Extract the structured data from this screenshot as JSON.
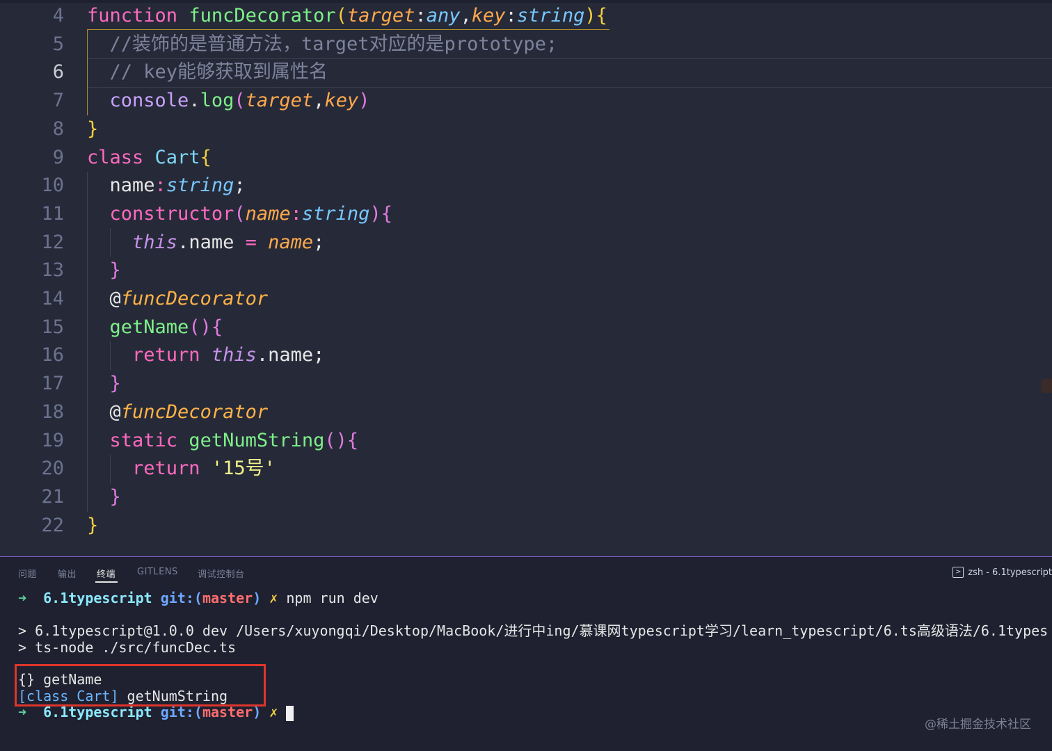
{
  "editor": {
    "lines": [
      {
        "num": "4",
        "active": false,
        "tokens": [
          [
            "kw",
            "function"
          ],
          [
            "pun",
            " "
          ],
          [
            "fnc",
            "funcDecorator"
          ],
          [
            "br1",
            "("
          ],
          [
            "par",
            "target"
          ],
          [
            "pun",
            ":"
          ],
          [
            "typ",
            "any"
          ],
          [
            "pun",
            ","
          ],
          [
            "par",
            "key"
          ],
          [
            "pun",
            ":"
          ],
          [
            "typ",
            "string"
          ],
          [
            "br1",
            ")"
          ],
          [
            "br1",
            "{"
          ]
        ]
      },
      {
        "num": "5",
        "active": false,
        "tokens": [
          [
            "pun",
            "  "
          ],
          [
            "com",
            "//装饰的是普通方法，target对应的是prototype;"
          ]
        ]
      },
      {
        "num": "6",
        "active": true,
        "tokens": [
          [
            "pun",
            "  "
          ],
          [
            "com",
            "// key能够获取到属性名"
          ]
        ]
      },
      {
        "num": "7",
        "active": false,
        "tokens": [
          [
            "pun",
            "  "
          ],
          [
            "prop",
            "console"
          ],
          [
            "pun",
            "."
          ],
          [
            "fnc",
            "log"
          ],
          [
            "br2",
            "("
          ],
          [
            "par",
            "target"
          ],
          [
            "pun",
            ","
          ],
          [
            "par",
            "key"
          ],
          [
            "br2",
            ")"
          ]
        ]
      },
      {
        "num": "8",
        "active": false,
        "tokens": [
          [
            "br1",
            "}"
          ]
        ]
      },
      {
        "num": "9",
        "active": false,
        "tokens": [
          [
            "kw",
            "class"
          ],
          [
            "pun",
            " "
          ],
          [
            "cls",
            "Cart"
          ],
          [
            "br1",
            "{"
          ]
        ]
      },
      {
        "num": "10",
        "active": false,
        "tokens": [
          [
            "pun",
            "  name"
          ],
          [
            "kw",
            ":"
          ],
          [
            "typ",
            "string"
          ],
          [
            "pun",
            ";"
          ]
        ]
      },
      {
        "num": "11",
        "active": false,
        "tokens": [
          [
            "pun",
            "  "
          ],
          [
            "kw",
            "constructor"
          ],
          [
            "br2",
            "("
          ],
          [
            "par",
            "name"
          ],
          [
            "kw",
            ":"
          ],
          [
            "typ",
            "string"
          ],
          [
            "br2",
            ")"
          ],
          [
            "br2",
            "{"
          ]
        ]
      },
      {
        "num": "12",
        "active": false,
        "tokens": [
          [
            "pun",
            "    "
          ],
          [
            "thisk",
            "this"
          ],
          [
            "pun",
            ".name "
          ],
          [
            "kw",
            "="
          ],
          [
            "pun",
            " "
          ],
          [
            "par",
            "name"
          ],
          [
            "pun",
            ";"
          ]
        ]
      },
      {
        "num": "13",
        "active": false,
        "tokens": [
          [
            "pun",
            "  "
          ],
          [
            "br2",
            "}"
          ]
        ]
      },
      {
        "num": "14",
        "active": false,
        "tokens": [
          [
            "pun",
            "  "
          ],
          [
            "at",
            "@"
          ],
          [
            "dec",
            "funcDecorator"
          ]
        ]
      },
      {
        "num": "15",
        "active": false,
        "tokens": [
          [
            "pun",
            "  "
          ],
          [
            "fnc",
            "getName"
          ],
          [
            "br2",
            "()"
          ],
          [
            "br2",
            "{"
          ]
        ]
      },
      {
        "num": "16",
        "active": false,
        "tokens": [
          [
            "pun",
            "    "
          ],
          [
            "kw",
            "return"
          ],
          [
            "pun",
            " "
          ],
          [
            "thisk",
            "this"
          ],
          [
            "pun",
            ".name;"
          ]
        ]
      },
      {
        "num": "17",
        "active": false,
        "tokens": [
          [
            "pun",
            "  "
          ],
          [
            "br2",
            "}"
          ]
        ]
      },
      {
        "num": "18",
        "active": false,
        "tokens": [
          [
            "pun",
            "  "
          ],
          [
            "at",
            "@"
          ],
          [
            "dec",
            "funcDecorator"
          ]
        ]
      },
      {
        "num": "19",
        "active": false,
        "tokens": [
          [
            "pun",
            "  "
          ],
          [
            "kw",
            "static"
          ],
          [
            "pun",
            " "
          ],
          [
            "fnc",
            "getNumString"
          ],
          [
            "br2",
            "()"
          ],
          [
            "br2",
            "{"
          ]
        ]
      },
      {
        "num": "20",
        "active": false,
        "tokens": [
          [
            "pun",
            "    "
          ],
          [
            "kw",
            "return"
          ],
          [
            "pun",
            " "
          ],
          [
            "str",
            "'15号'"
          ]
        ]
      },
      {
        "num": "21",
        "active": false,
        "tokens": [
          [
            "pun",
            "  "
          ],
          [
            "br2",
            "}"
          ]
        ]
      },
      {
        "num": "22",
        "active": false,
        "tokens": [
          [
            "br1",
            "}"
          ]
        ]
      }
    ]
  },
  "panel": {
    "tabs": [
      {
        "label": "问题",
        "active": false
      },
      {
        "label": "输出",
        "active": false
      },
      {
        "label": "终端",
        "active": true
      },
      {
        "label": "GITLENS",
        "active": false
      },
      {
        "label": "调试控制台",
        "active": false
      }
    ],
    "terminal_title": "zsh - 6.1typescript",
    "prompt1": {
      "arrow": "➜",
      "dir": "6.1typescript",
      "git": "git:",
      "branch_open": "(",
      "branch": "master",
      "branch_close": ")",
      "x": "✗",
      "cmd": "npm run dev"
    },
    "out1": "> 6.1typescript@1.0.0 dev /Users/xuyongqi/Desktop/MacBook/进行中ing/慕课网typescript学习/learn_typescript/6.ts高级语法/6.1types",
    "out2": "> ts-node ./src/funcDec.ts",
    "result1": "{} getName",
    "result2_class": "[class Cart]",
    "result2_name": " getNumString",
    "prompt2": {
      "arrow": "➜",
      "dir": "6.1typescript",
      "git": "git:",
      "branch_open": "(",
      "branch": "master",
      "branch_close": ")",
      "x": "✗"
    }
  },
  "watermark": "@稀土掘金技术社区"
}
